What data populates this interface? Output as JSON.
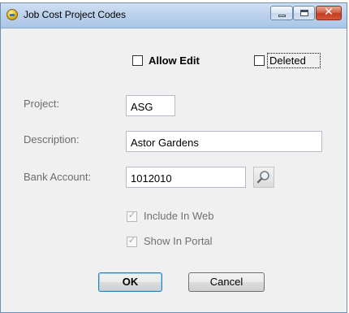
{
  "window": {
    "title": "Job Cost Project Codes"
  },
  "options": {
    "allow_edit": {
      "label": "Allow Edit",
      "checked": false
    },
    "deleted": {
      "label": "Deleted",
      "checked": false
    }
  },
  "fields": {
    "project": {
      "label": "Project:",
      "value": "ASG"
    },
    "description": {
      "label": "Description:",
      "value": "Astor Gardens"
    },
    "bank_account": {
      "label": "Bank Account:",
      "value": "1012010"
    }
  },
  "flags": {
    "include_in_web": {
      "label": "Include In Web",
      "checked": true,
      "enabled": false
    },
    "show_in_portal": {
      "label": "Show In Portal",
      "checked": true,
      "enabled": false
    }
  },
  "buttons": {
    "ok": "OK",
    "cancel": "Cancel"
  },
  "icons": {
    "app": "app-icon",
    "lookup": "search-icon",
    "check": "✓"
  },
  "colors": {
    "titlebar": "#bcd2ec",
    "close": "#c33d22",
    "dialog_bg": "#f0f0f0"
  }
}
